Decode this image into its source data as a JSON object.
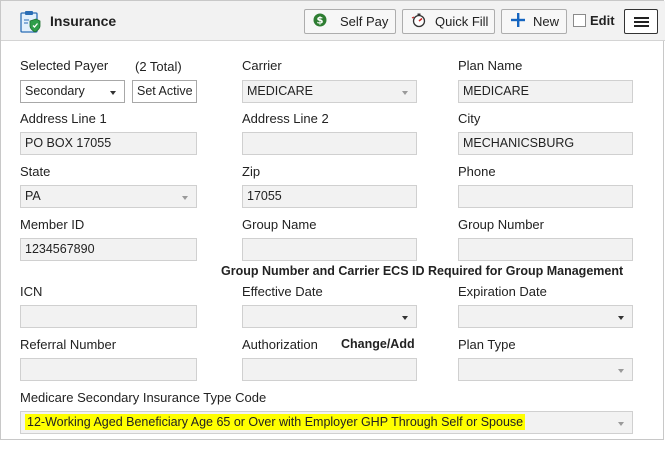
{
  "header": {
    "title": "Insurance",
    "self_pay_label": "Self Pay",
    "quick_fill_label": "Quick Fill",
    "new_label": "New",
    "edit_label": "Edit"
  },
  "payer": {
    "selected_label": "Selected Payer",
    "total_label": "(2 Total)",
    "selected_value": "Secondary",
    "set_active_label": "Set Active"
  },
  "fields": {
    "carrier_label": "Carrier",
    "carrier_value": "MEDICARE",
    "plan_name_label": "Plan Name",
    "plan_name_value": "MEDICARE",
    "address1_label": "Address Line 1",
    "address1_value": "PO BOX 17055",
    "address2_label": "Address Line 2",
    "address2_value": "",
    "city_label": "City",
    "city_value": "MECHANICSBURG",
    "state_label": "State",
    "state_value": "PA",
    "zip_label": "Zip",
    "zip_value": "17055",
    "phone_label": "Phone",
    "phone_value": "",
    "member_id_label": "Member ID",
    "member_id_value": "1234567890",
    "group_name_label": "Group Name",
    "group_name_value": "",
    "group_number_label": "Group Number",
    "group_number_value": "",
    "group_note": "Group Number and Carrier ECS ID Required for Group Management",
    "icn_label": "ICN",
    "icn_value": "",
    "effective_date_label": "Effective Date",
    "effective_date_value": "",
    "expiration_date_label": "Expiration Date",
    "expiration_date_value": "",
    "referral_label": "Referral Number",
    "referral_value": "",
    "authorization_label": "Authorization",
    "authorization_value": "",
    "change_add_label": "Change/Add",
    "plan_type_label": "Plan Type",
    "plan_type_value": "",
    "msp_label": "Medicare Secondary Insurance Type Code",
    "msp_value": "12-Working Aged Beneficiary Age 65 or Over with Employer GHP Through Self or Spouse"
  },
  "colors": {
    "highlight": "#ffff00",
    "self_pay_icon": "#2e7d32",
    "new_icon": "#1565c0",
    "quick_fill_icon": "#c62828"
  },
  "icons": {
    "header": "insurance-shield-clipboard-icon",
    "self_pay": "dollar-circle-icon",
    "quick_fill": "stopwatch-icon",
    "new": "plus-icon",
    "menu": "hamburger-menu-icon"
  }
}
